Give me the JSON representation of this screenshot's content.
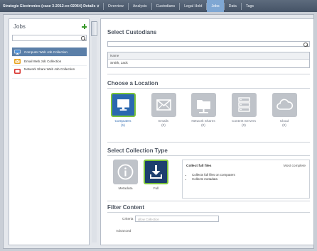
{
  "topbar": {
    "breadcrumb": "Strategic Electronics (case 3-2012-cv-02064) Details ∨",
    "tabs": [
      {
        "label": "Overview"
      },
      {
        "label": "Analysis"
      },
      {
        "label": "Custodians"
      },
      {
        "label": "Legal Hold"
      },
      {
        "label": "Jobs",
        "active": true
      },
      {
        "label": "Data"
      },
      {
        "label": "Tags"
      }
    ]
  },
  "jobs_panel": {
    "title": "Jobs",
    "search_placeholder": "",
    "items": [
      {
        "label": "Computer Web Job Collection",
        "icon": "computer-icon",
        "color": "#4a8fd8",
        "selected": true
      },
      {
        "label": "Email Web Job Collection",
        "icon": "email-icon",
        "color": "#e8a21c"
      },
      {
        "label": "Network Share Web Job Collection",
        "icon": "network-share-icon",
        "color": "#d8302b"
      }
    ]
  },
  "select_custodians": {
    "title": "Select Custodians",
    "search_placeholder": "",
    "column_header": "Name",
    "rows": [
      "Smith, Jack"
    ]
  },
  "choose_location": {
    "title": "Choose a Location",
    "locations": [
      {
        "label": "Computers",
        "count": "(1)",
        "icon": "monitor-icon",
        "active": true
      },
      {
        "label": "Emails",
        "count": "(0)",
        "icon": "envelope-icon"
      },
      {
        "label": "Network Shares",
        "count": "(0)",
        "icon": "folder-icon"
      },
      {
        "label": "Content Servers",
        "count": "(0)",
        "icon": "server-icon"
      },
      {
        "label": "Cloud",
        "count": "(0)",
        "icon": "cloud-icon"
      }
    ]
  },
  "collection_type": {
    "title": "Select Collection Type",
    "types": [
      {
        "label": "Metadata",
        "icon": "info-icon"
      },
      {
        "label": "Full",
        "icon": "download-icon",
        "active": true
      }
    ],
    "description": {
      "title": "Collect full files",
      "tag": "Most complete",
      "bullets": [
        "Collects full files on computers",
        "Collects metadata"
      ]
    }
  },
  "filter_content": {
    "title": "Filter Content",
    "criteria_label": "Criteria",
    "criteria_placeholder": "allow Collection",
    "advanced_label": "Advanced"
  },
  "colors": {
    "topbar": "#4f5d70",
    "active_tab": "#7fa7d3",
    "selected_job": "#5b7fa8",
    "active_tile": "#2b68b0",
    "active_border": "#7cc43a",
    "tile_inactive": "#bfc3c9"
  }
}
